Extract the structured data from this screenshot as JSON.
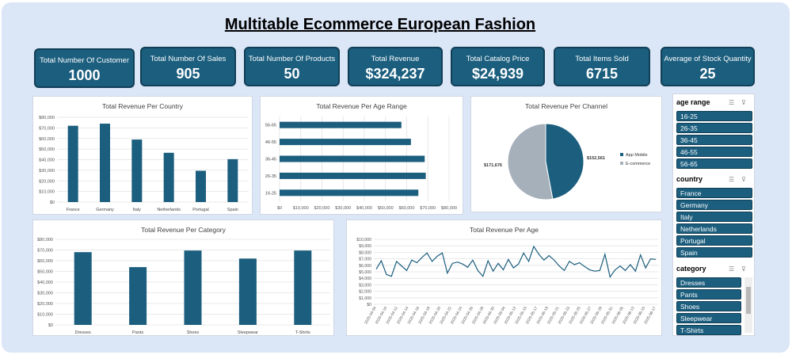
{
  "title": "Multitable Ecommerce European Fashion",
  "kpis": [
    {
      "label": "Total Number Of Customer",
      "value": "1000"
    },
    {
      "label": "Total Number Of Sales",
      "value": "905"
    },
    {
      "label": "Total Number Of Products",
      "value": "50"
    },
    {
      "label": "Total Revenue",
      "value": "$324,237"
    },
    {
      "label": "Total Catalog Price",
      "value": "$24,939"
    },
    {
      "label": "Total Items Sold",
      "value": "6715"
    },
    {
      "label": "Average of Stock Quantity",
      "value": "25"
    }
  ],
  "colors": {
    "bar": "#1b5e7e",
    "pie_mobile": "#1b5e7e",
    "pie_ecommerce": "#a6b0bb",
    "kpi_bg": "#1b5e7e",
    "board_bg": "#dbe6f7"
  },
  "slicers": {
    "age": {
      "title": "age range",
      "items": [
        "16-25",
        "26-35",
        "36-45",
        "46-55",
        "56-65"
      ]
    },
    "country": {
      "title": "country",
      "items": [
        "France",
        "Germany",
        "Italy",
        "Netherlands",
        "Portugal",
        "Spain"
      ]
    },
    "category": {
      "title": "category",
      "items": [
        "Dresses",
        "Pants",
        "Shoes",
        "Sleepwear",
        "T-Shirts"
      ]
    },
    "icons": [
      "multi-select-icon",
      "clear-filter-icon"
    ]
  },
  "chart_data": [
    {
      "type": "bar",
      "title": "Total Revenue Per Country",
      "categories": [
        "France",
        "Germany",
        "Italy",
        "Netherlands",
        "Portugal",
        "Spain"
      ],
      "values": [
        72000,
        74000,
        59000,
        46500,
        29500,
        40500
      ],
      "ylim": [
        0,
        80000
      ],
      "yticks": [
        "$0",
        "$10,000",
        "$20,000",
        "$30,000",
        "$40,000",
        "$50,000",
        "$60,000",
        "$70,000",
        "$80,000"
      ],
      "grid": true
    },
    {
      "type": "bar",
      "orientation": "horizontal",
      "title": "Total Revenue Per Age Range",
      "categories": [
        "16-25",
        "26-35",
        "36-45",
        "46-55",
        "56-65"
      ],
      "values": [
        65500,
        69000,
        68500,
        62000,
        57500
      ],
      "xlim": [
        0,
        80000
      ],
      "xticks": [
        "$0",
        "$10,000",
        "$20,000",
        "$30,000",
        "$40,000",
        "$50,000",
        "$60,000",
        "$70,000",
        "$80,000"
      ],
      "grid": true
    },
    {
      "type": "pie",
      "title": "Total Revenue Per Channel",
      "categories": [
        "App Mobile",
        "E-commerce"
      ],
      "values": [
        152561,
        171676
      ],
      "data_labels": [
        "$152,561",
        "$171,676"
      ],
      "legend": "right"
    },
    {
      "type": "bar",
      "title": "Total Revenue Per Category",
      "categories": [
        "Dresses",
        "Pants",
        "Shoes",
        "Sleepwear",
        "T-Shirts"
      ],
      "values": [
        68000,
        54000,
        69500,
        62000,
        69500
      ],
      "ylim": [
        0,
        80000
      ],
      "yticks": [
        "$0",
        "$10,000",
        "$20,000",
        "$30,000",
        "$40,000",
        "$50,000",
        "$60,000",
        "$70,000",
        "$80,000"
      ],
      "grid": true
    },
    {
      "type": "line",
      "title": "Total Revenue Per Age",
      "x": [
        "2025-04-04",
        "2025-04-10",
        "2025-04-12",
        "2025-04-14",
        "2025-04-16",
        "2025-04-18",
        "2025-04-20",
        "2025-04-22",
        "2025-04-24",
        "2025-04-26",
        "2025-04-28",
        "2025-04-30",
        "2025-05-04",
        "2025-05-13",
        "2025-05-15",
        "2025-05-17",
        "2025-05-19",
        "2025-05-21",
        "2025-05-23",
        "2025-05-25",
        "2025-05-27",
        "2025-05-29",
        "2025-05-31",
        "2025-06-05",
        "2025-06-13",
        "2025-06-15",
        "2025-06-17"
      ],
      "values": [
        5400,
        6700,
        4600,
        4300,
        6600,
        5900,
        5200,
        6800,
        6400,
        7200,
        7900,
        6600,
        7400,
        7900,
        4800,
        6300,
        6500,
        6200,
        5700,
        6800,
        5200,
        4300,
        6700,
        5100,
        6300,
        5300,
        6900,
        5600,
        6200,
        7900,
        6600,
        8900,
        7700,
        6800,
        7500,
        6800,
        5900,
        5200,
        6600,
        6100,
        6400,
        5800,
        5300,
        5100,
        5200,
        7700,
        4200,
        5300,
        5900,
        5200,
        6100,
        5100,
        7600,
        5600,
        7000,
        6900
      ],
      "ylim": [
        0,
        10000
      ],
      "yticks": [
        "$0",
        "$1,000",
        "$2,000",
        "$3,000",
        "$4,000",
        "$5,000",
        "$6,000",
        "$7,000",
        "$8,000",
        "$9,000",
        "$10,000"
      ],
      "grid": true
    }
  ]
}
